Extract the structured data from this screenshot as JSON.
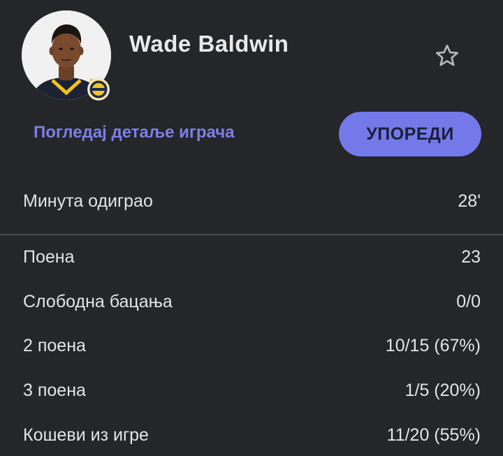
{
  "player": {
    "name": "Wade Baldwin"
  },
  "actions": {
    "details_link": "Погледај детаље играча",
    "compare_button": "УПОРЕДИ"
  },
  "icons": {
    "favorite": "star-outline-icon",
    "club": "club-badge-icon"
  },
  "colors": {
    "background": "#24262a",
    "accent": "#7479ea",
    "link": "#7c7fe6",
    "divider": "#4a4c52"
  },
  "minutes": {
    "label": "Минута одиграо",
    "value": "28'"
  },
  "stats": [
    {
      "label": "Поена",
      "value": "23"
    },
    {
      "label": "Слободна бацања",
      "value": "0/0"
    },
    {
      "label": "2 поена",
      "value": "10/15 (67%)"
    },
    {
      "label": "3 поена",
      "value": "1/5 (20%)"
    },
    {
      "label": "Кошеви из игре",
      "value": "11/20 (55%)"
    }
  ]
}
